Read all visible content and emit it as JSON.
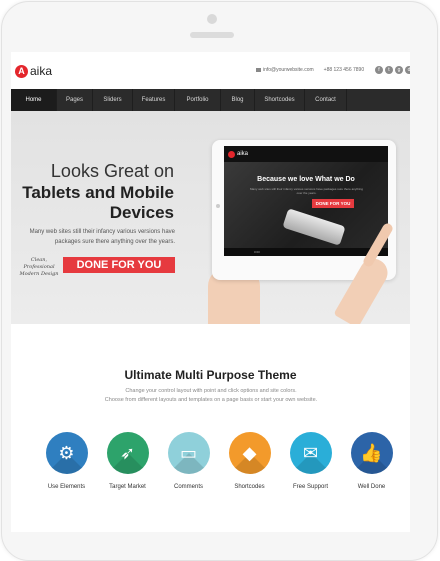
{
  "header": {
    "logo_mark": "A",
    "logo_text": "aika",
    "email": "info@yourwebsite.com",
    "phone": "+88 123 456 7890",
    "socials": [
      {
        "name": "facebook-icon",
        "glyph": "f"
      },
      {
        "name": "twitter-icon",
        "glyph": "t"
      },
      {
        "name": "google-plus-icon",
        "glyph": "g"
      },
      {
        "name": "dribbble-icon",
        "glyph": "d"
      }
    ]
  },
  "nav": {
    "items": [
      {
        "label": "Home",
        "active": true
      },
      {
        "label": "Pages"
      },
      {
        "label": "Sliders"
      },
      {
        "label": "Features"
      },
      {
        "label": "Portfolio"
      },
      {
        "label": "Blog"
      },
      {
        "label": "Shortcodes"
      },
      {
        "label": "Contact"
      }
    ]
  },
  "hero": {
    "line1": "Looks Great on",
    "line2": "Tablets and Mobile",
    "line3": "Devices",
    "description": "Many web sites still their infancy various versions have packages sure there anything over the years.",
    "signature": "Clean, Professional Modern Design",
    "cta_label": "DONE FOR YOU",
    "tablet": {
      "logo": "aika",
      "headline": "Because we love What we Do",
      "sub": "Many web sites still their infancy various versions have packages sure there anything over the years.",
      "button": "DONE FOR YOU",
      "player_time": "0:00"
    }
  },
  "features": {
    "title": "Ultimate Multi Purpose Theme",
    "subtitle_1": "Change your control layout with point and click options and site colors.",
    "subtitle_2": "Choose from different layouts and templates on a page basis or start your own website.",
    "items": [
      {
        "label": "Use Elements",
        "icon": "gear-icon",
        "glyph": "⚙",
        "color": "#2f7fc0"
      },
      {
        "label": "Target Market",
        "icon": "compass-icon",
        "glyph": "➶",
        "color": "#2da36b"
      },
      {
        "label": "Comments",
        "icon": "comment-icon",
        "glyph": "▭",
        "color": "#8fd0da"
      },
      {
        "label": "Shortcodes",
        "icon": "tag-icon",
        "glyph": "◆",
        "color": "#f39a2b"
      },
      {
        "label": "Free Support",
        "icon": "envelope-icon",
        "glyph": "✉",
        "color": "#2aaed8"
      },
      {
        "label": "Well Done",
        "icon": "thumbs-up-icon",
        "glyph": "👍",
        "color": "#2c64a8"
      }
    ]
  }
}
